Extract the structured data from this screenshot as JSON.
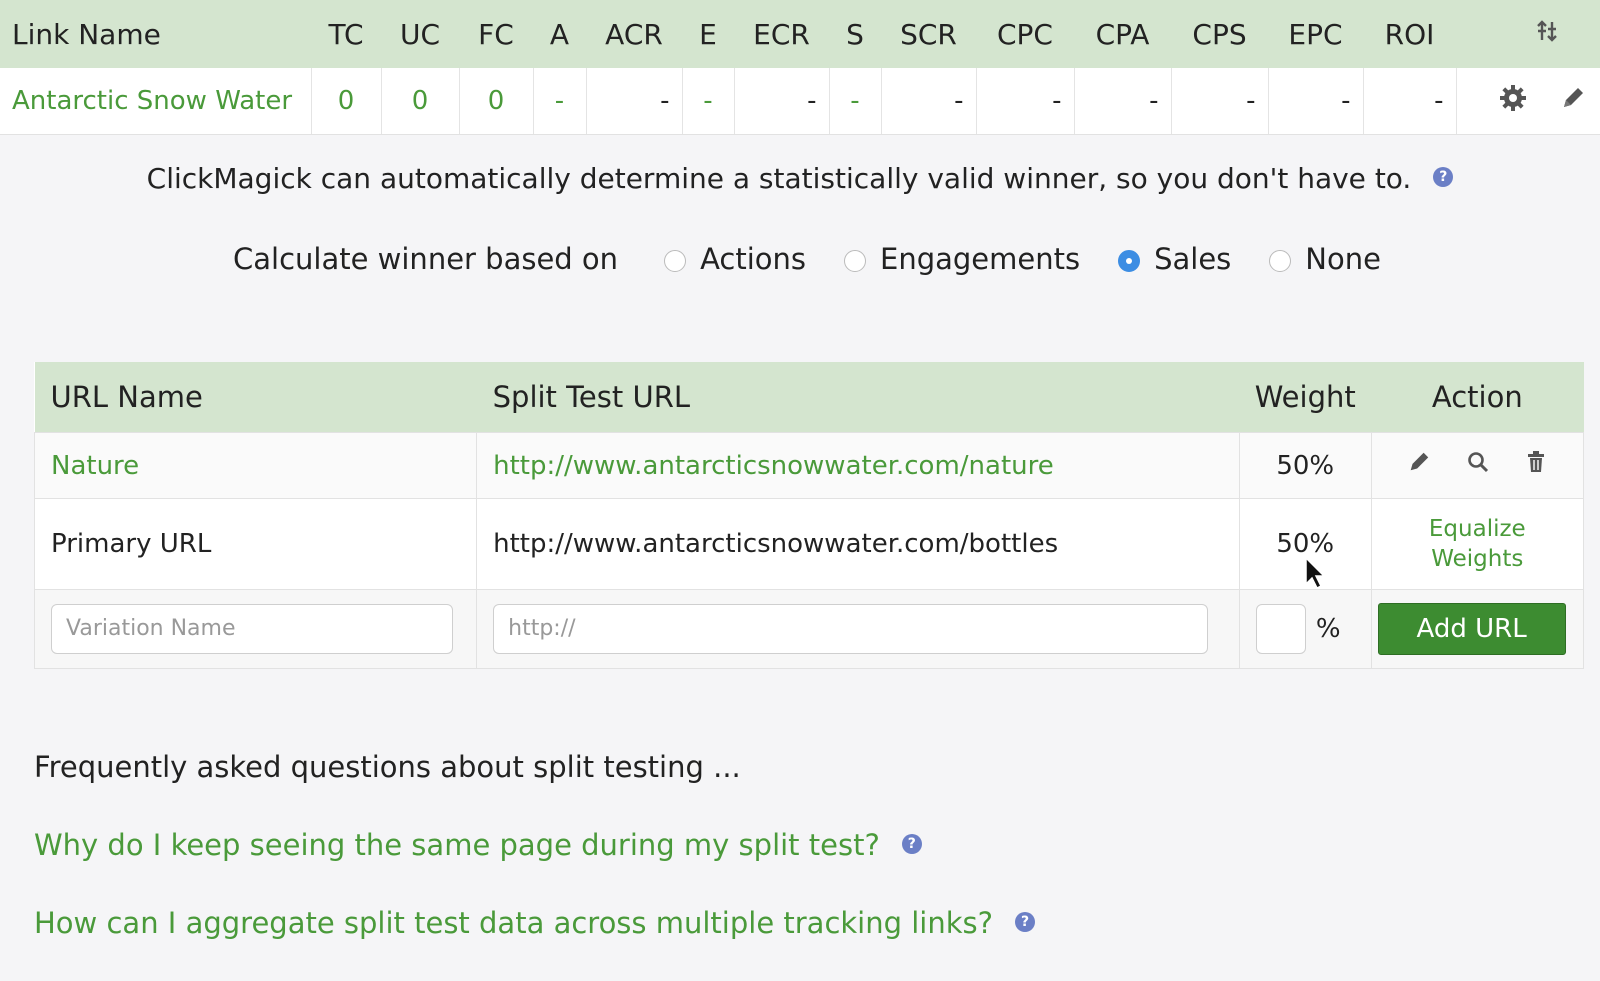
{
  "stats_table": {
    "headers": [
      "Link Name",
      "TC",
      "UC",
      "FC",
      "A",
      "ACR",
      "E",
      "ECR",
      "S",
      "SCR",
      "CPC",
      "CPA",
      "CPS",
      "EPC",
      "ROI"
    ],
    "row": {
      "link_name": "Antarctic Snow Water",
      "tc": "0",
      "uc": "0",
      "fc": "0",
      "a": "-",
      "acr": "-",
      "e": "-",
      "ecr": "-",
      "s": "-",
      "scr": "-",
      "cpc": "-",
      "cpa": "-",
      "cps": "-",
      "epc": "-",
      "roi": "-"
    },
    "icons": [
      "sort-columns-icon",
      "gear-icon",
      "pencil-icon"
    ]
  },
  "notice": "ClickMagick can automatically determine a statistically valid winner, so you don't have to.",
  "winner": {
    "label": "Calculate winner based on",
    "options": [
      "Actions",
      "Engagements",
      "Sales",
      "None"
    ],
    "selected": "Sales"
  },
  "split_table": {
    "headers": {
      "url_name": "URL Name",
      "split_url": "Split Test URL",
      "weight": "Weight",
      "action": "Action"
    },
    "rows": [
      {
        "name": "Nature",
        "url": "http://www.antarcticsnowwater.com/nature",
        "weight": "50%"
      },
      {
        "name": "Primary URL",
        "url": "http://www.antarcticsnowwater.com/bottles",
        "weight": "50%",
        "action_line1": "Equalize",
        "action_line2": "Weights"
      }
    ],
    "new_row": {
      "name_placeholder": "Variation Name",
      "url_placeholder": "http://",
      "weight_value": "",
      "percent": "%",
      "add_button": "Add URL"
    }
  },
  "faq": {
    "heading": "Frequently asked questions about split testing ...",
    "questions": [
      "Why do I keep seeing the same page during my split test?",
      "How can I aggregate split test data across multiple tracking links?"
    ]
  },
  "colors": {
    "accent_green": "#4a9a3a",
    "header_green": "#d4e5cf",
    "button_green": "#3d8c31",
    "radio_blue": "#3c8de3"
  }
}
